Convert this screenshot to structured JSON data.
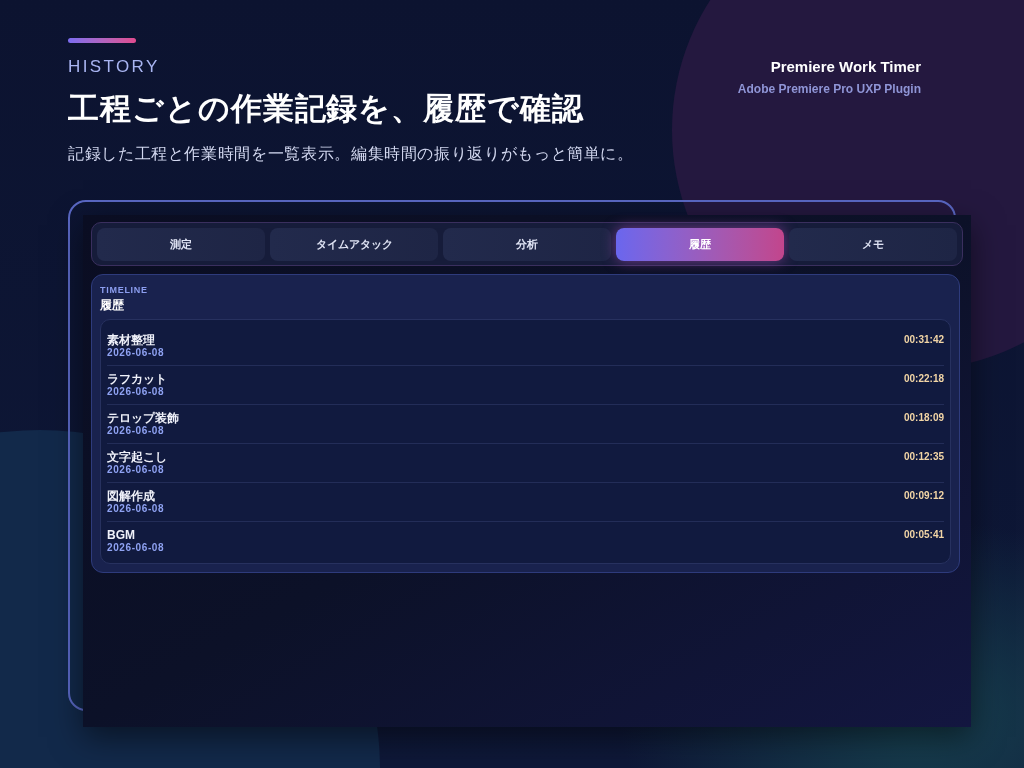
{
  "header": {
    "eyebrow": "HISTORY",
    "title": "工程ごとの作業記録を、履歴で確認",
    "subtitle": "記録した工程と作業時間を一覧表示。編集時間の振り返りがもっと簡単に。"
  },
  "product": {
    "name": "Premiere Work Timer",
    "tagline": "Adobe Premiere Pro UXP Plugin"
  },
  "app": {
    "tabs": [
      {
        "label": "測定",
        "selected": false
      },
      {
        "label": "タイムアタック",
        "selected": false
      },
      {
        "label": "分析",
        "selected": false
      },
      {
        "label": "履歴",
        "selected": true
      },
      {
        "label": "メモ",
        "selected": false
      }
    ],
    "history": {
      "eyebrow": "TIMELINE",
      "title": "履歴",
      "entries": [
        {
          "task": "素材整理",
          "date": "2026-06-08",
          "duration": "00:31:42"
        },
        {
          "task": "ラフカット",
          "date": "2026-06-08",
          "duration": "00:22:18"
        },
        {
          "task": "テロップ装飾",
          "date": "2026-06-08",
          "duration": "00:18:09"
        },
        {
          "task": "文字起こし",
          "date": "2026-06-08",
          "duration": "00:12:35"
        },
        {
          "task": "図解作成",
          "date": "2026-06-08",
          "duration": "00:09:12"
        },
        {
          "task": "BGM",
          "date": "2026-06-08",
          "duration": "00:05:41"
        }
      ]
    }
  }
}
